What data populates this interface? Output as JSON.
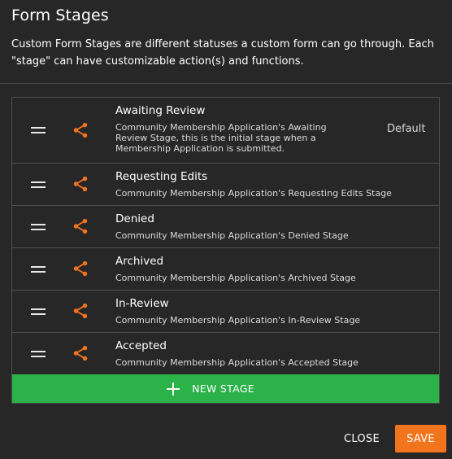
{
  "dialog": {
    "title": "Form Stages",
    "description": "Custom Form Stages are different statuses a custom form can go through. Each \"stage\" can have customizable action(s) and functions."
  },
  "stages": [
    {
      "name": "Awaiting Review",
      "description": "Community Membership Application's Awaiting Review Stage, this is the initial stage when a Membership Application is submitted.",
      "badge": "Default"
    },
    {
      "name": "Requesting Edits",
      "description": "Community Membership Application's Requesting Edits Stage"
    },
    {
      "name": "Denied",
      "description": "Community Membership Application's Denied Stage"
    },
    {
      "name": "Archived",
      "description": "Community Membership Application's Archived Stage"
    },
    {
      "name": "In-Review",
      "description": "Community Membership Application's In-Review Stage"
    },
    {
      "name": "Accepted",
      "description": "Community Membership Application's Accepted Stage"
    }
  ],
  "actions": {
    "new_stage": "NEW STAGE",
    "close": "CLOSE",
    "save": "SAVE"
  },
  "colors": {
    "background": "#272727",
    "accent_orange": "#f2741c",
    "accent_green": "#2bb34a",
    "border": "#4d4d4d"
  },
  "icons": {
    "drag": "drag-handle-icon",
    "share": "share-icon",
    "add": "plus-icon"
  }
}
